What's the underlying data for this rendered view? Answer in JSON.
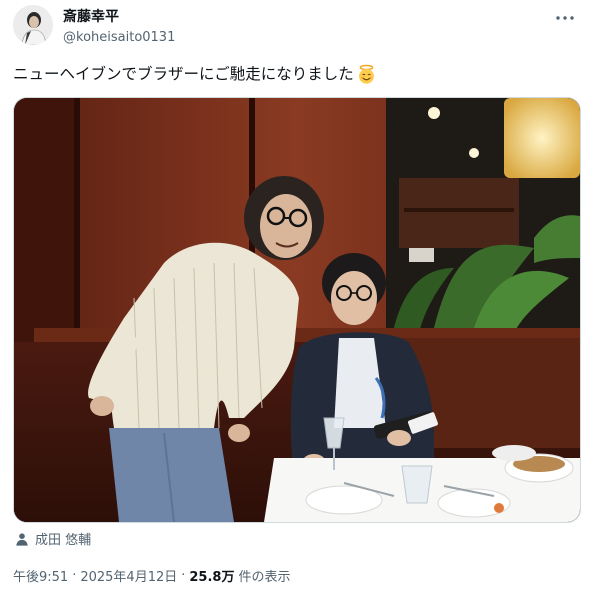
{
  "author": {
    "display_name": "斎藤幸平",
    "handle": "@koheisaito0131",
    "avatar_icon": "avatar-photo"
  },
  "tweet": {
    "text": "ニューヘイブンでブラザーにご馳走になりました",
    "emoji": "smiling-face-with-halo-emoji"
  },
  "tagged": {
    "icon": "person-icon",
    "name": "成田 悠輔"
  },
  "meta": {
    "time": "午後9:51",
    "separator": "·",
    "date": "2025年4月12日",
    "views_count": "25.8万",
    "views_label": "件の表示"
  },
  "colors": {
    "text_primary": "#0f1419",
    "text_secondary": "#536471",
    "border": "#cfd9de"
  }
}
